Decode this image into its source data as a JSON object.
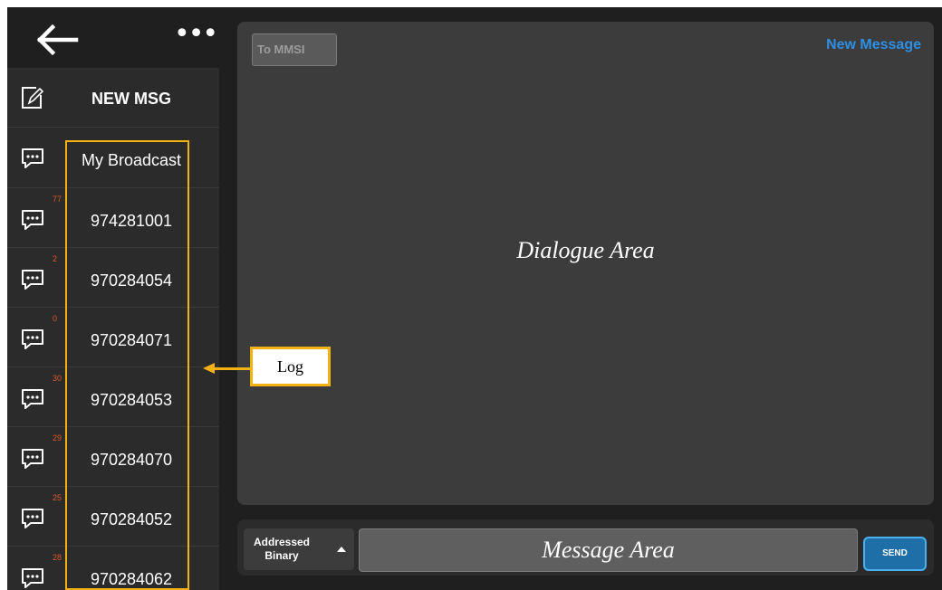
{
  "header": {
    "back_icon": "arrow-left-icon",
    "more_icon": "more-horizontal-icon",
    "more_label": "•••"
  },
  "new_msg": {
    "label": "NEW MSG",
    "icon": "compose-icon"
  },
  "conversations": [
    {
      "label": "My Broadcast",
      "badge": "",
      "icon": "chat-bubble-icon"
    },
    {
      "label": "974281001",
      "badge": "77",
      "icon": "chat-bubble-icon"
    },
    {
      "label": "970284054",
      "badge": "2",
      "icon": "chat-bubble-icon"
    },
    {
      "label": "970284071",
      "badge": "0",
      "icon": "chat-bubble-icon"
    },
    {
      "label": "970284053",
      "badge": "30",
      "icon": "chat-bubble-icon"
    },
    {
      "label": "970284070",
      "badge": "29",
      "icon": "chat-bubble-icon"
    },
    {
      "label": "970284052",
      "badge": "25",
      "icon": "chat-bubble-icon"
    },
    {
      "label": "970284062",
      "badge": "28",
      "icon": "chat-bubble-icon"
    }
  ],
  "dialogue": {
    "to_mmsi_label": "To MMSI",
    "new_message_label": "New Message",
    "caption": "Dialogue Area"
  },
  "composer": {
    "type_line1": "Addressed",
    "type_line2": "Binary",
    "message_caption": "Message Area",
    "send_label": "SEND"
  },
  "annotation": {
    "log_label": "Log"
  },
  "colors": {
    "accent_blue": "#2f8fe6",
    "annotation_yellow": "#f3b211",
    "badge_orange": "#e0562a",
    "send_blue": "#1e6fa8"
  }
}
